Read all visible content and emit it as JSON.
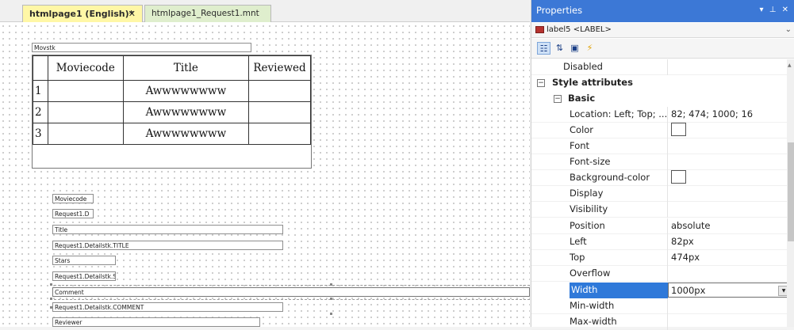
{
  "tabs": [
    {
      "label": "htmlpage1 (English)*",
      "close": "✕"
    },
    {
      "label": "htmlpage1_Request1.mnt"
    }
  ],
  "canvas": {
    "form_label": "Movstk",
    "table": {
      "headers": [
        "Moviecode",
        "Title",
        "Reviewed"
      ],
      "rows": [
        {
          "n": "1",
          "title": "Awwwwwwww"
        },
        {
          "n": "2",
          "title": "Awwwwwwww"
        },
        {
          "n": "3",
          "title": "Awwwwwwww"
        }
      ]
    },
    "fields": {
      "moviecode_label": "Moviecode",
      "moviecode_value": "Request1.D",
      "title_label": "Title",
      "title_value": "Request1.Detailstk.TITLE",
      "stars_label": "Stars",
      "stars_value": "Request1.Detailstk.S",
      "comment_label": "Comment",
      "comment_value": "Request1.Detailstk.COMMENT",
      "reviewer_label": "Reviewer"
    }
  },
  "properties": {
    "title": "Properties",
    "pin_icons": "▾ ⊥ ✕",
    "object": "label5 <LABEL>",
    "object_dropdown": "⌄",
    "rows": {
      "disabled": "Disabled",
      "style_attributes": "Style attributes",
      "basic": "Basic",
      "location_name": "Location: Left; Top; ...",
      "location_value": "82; 474; 1000; 16",
      "color": "Color",
      "font": "Font",
      "font_size": "Font-size",
      "background_color": "Background-color",
      "display": "Display",
      "visibility": "Visibility",
      "position_name": "Position",
      "position_value": "absolute",
      "left_name": "Left",
      "left_value": "82px",
      "top_name": "Top",
      "top_value": "474px",
      "overflow": "Overflow",
      "width_name": "Width",
      "width_value": "1000px",
      "min_width": "Min-width",
      "max_width": "Max-width"
    }
  }
}
